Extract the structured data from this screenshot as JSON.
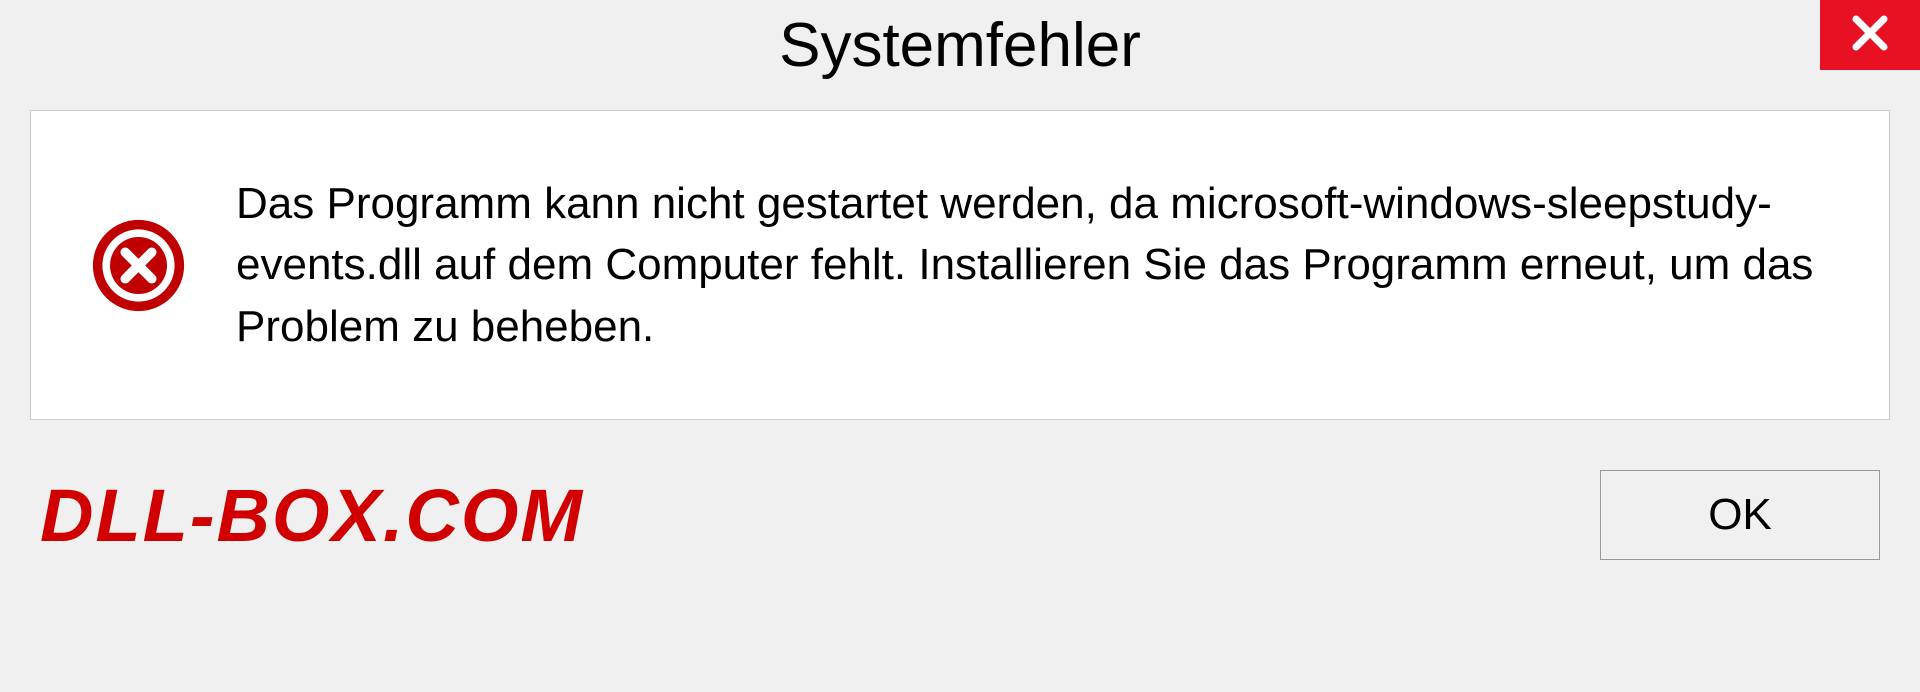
{
  "titlebar": {
    "title": "Systemfehler"
  },
  "message": {
    "text": "Das Programm kann nicht gestartet werden, da microsoft-windows-sleepstudy-events.dll auf dem Computer fehlt. Installieren Sie das Programm erneut, um das Problem zu beheben."
  },
  "footer": {
    "watermark": "DLL-BOX.COM",
    "ok_label": "OK"
  },
  "colors": {
    "close_button_bg": "#e81123",
    "error_icon": "#c00000",
    "watermark": "#d00000"
  }
}
